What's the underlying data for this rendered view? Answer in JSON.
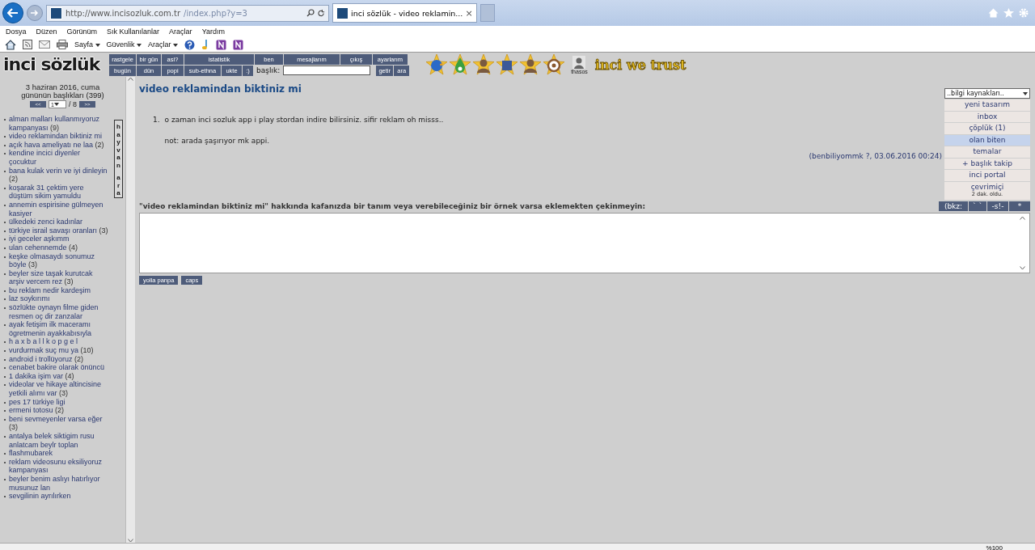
{
  "browser": {
    "address": {
      "host": "http://www.incisozluk.com.tr",
      "path": "/index.php?y=3"
    },
    "tabs": [
      {
        "title": "inci sözlük - video reklamin...",
        "close": "×",
        "selected": true
      }
    ],
    "menu": [
      "Dosya",
      "Düzen",
      "Görünüm",
      "Sık Kullanılanlar",
      "Araçlar",
      "Yardım"
    ],
    "commands": [
      {
        "kind": "home"
      },
      {
        "kind": "feed"
      },
      {
        "kind": "mail"
      },
      {
        "kind": "print"
      },
      {
        "kind": "menu",
        "label": "Sayfa"
      },
      {
        "kind": "menu",
        "label": "Güvenlik"
      },
      {
        "kind": "menu",
        "label": "Araçlar"
      },
      {
        "kind": "help"
      },
      {
        "kind": "note"
      },
      {
        "kind": "onenote"
      },
      {
        "kind": "onenote"
      }
    ]
  },
  "site": {
    "logo": "inci sözlük",
    "slogan": "inci we trust",
    "nav_row_1": [
      "rastgele",
      "bir gün",
      "asl?",
      "istatistik",
      "ben",
      "mesajlarım",
      "çıkış",
      "ayarlarım"
    ],
    "nav_row_2": [
      "bugün",
      "dün",
      "popi",
      "sub-ethna",
      "ukte",
      ":)"
    ],
    "search": {
      "label": "başlık:",
      "buttons": [
        "getir",
        "ara"
      ]
    },
    "badges": [
      {
        "kind": "bird"
      },
      {
        "kind": "drop"
      },
      {
        "kind": "person"
      },
      {
        "kind": "square"
      },
      {
        "kind": "person"
      },
      {
        "kind": "ring"
      }
    ],
    "user": {
      "name": "thasos"
    }
  },
  "sidebar": {
    "date": "3 haziran 2016, cuma",
    "heading": "gününün başlıkları (399)",
    "pager": {
      "prev": "<<",
      "page": "1",
      "total": "/ 8",
      "next": ">>"
    },
    "vertical_button": "hayvan ara",
    "topics": [
      {
        "title": "alman malları kullanmıyoruz kampanyası",
        "count": "(9)"
      },
      {
        "title": "video reklamindan biktiniz mi"
      },
      {
        "title": "açık hava ameliyatı ne laa",
        "count": "(2)"
      },
      {
        "title": "kendine incici diyenler çocuktur"
      },
      {
        "title": "bana kulak verin ve iyi dinleyin",
        "count": "(2)"
      },
      {
        "title": "koşarak 31 çektim yere düştüm sikim yamuldu"
      },
      {
        "title": "annemin espirisine gülmeyen kasiyer"
      },
      {
        "title": "ülkedeki zenci kadınlar"
      },
      {
        "title": "türkiye israil savaşı oranları",
        "count": "(3)"
      },
      {
        "title": "iyi geceler aşkımm"
      },
      {
        "title": "ulan cehennemde",
        "count": "(4)"
      },
      {
        "title": "keşke olmasaydı sonumuz böyle",
        "count": "(3)"
      },
      {
        "title": "beyler size taşak kurutcak arşiv vercem rez",
        "count": "(3)"
      },
      {
        "title": "bu reklam nedir kardeşim"
      },
      {
        "title": "laz soykırımı"
      },
      {
        "title": "sözlükte oynayn filme giden resmen oç dir zanzalar"
      },
      {
        "title": "ayak fetişim ilk maceramı ögretmenin ayakkabısıyla"
      },
      {
        "title": "h a x b a l l k o p g e l"
      },
      {
        "title": "vurdurmak suç mu ya",
        "count": "(10)"
      },
      {
        "title": "android i trollüyoruz",
        "count": "(2)"
      },
      {
        "title": "cenabet bakire olarak önüncü"
      },
      {
        "title": "1 dakika işim var",
        "count": "(4)"
      },
      {
        "title": "videolar ve hikaye altincisine yetkili alımı var",
        "count": "(3)"
      },
      {
        "title": "pes 17 türkiye ligi"
      },
      {
        "title": "ermeni totosu",
        "count": "(2)"
      },
      {
        "title": "beni sevmeyenler varsa eğer",
        "count": "(3)"
      },
      {
        "title": "antalya belek siktigim rusu anlatcam beylr toplan"
      },
      {
        "title": "flashmubarek"
      },
      {
        "title": "reklam videosunu eksiliyoruz kampanyası"
      },
      {
        "title": "beyler benim aslıyı hatırlıyor musunuz lan"
      },
      {
        "title": "sevgilinin ayrılırken"
      }
    ]
  },
  "topic": {
    "title": "video reklamindan biktiniz mi",
    "entries": [
      {
        "number": "1.",
        "paragraphs": [
          "o zaman inci sozluk app i play stordan indire bilirsiniz. sifir reklam oh misss..",
          "not: arada şaşırıyor mk appi."
        ],
        "author": "(benbiliyommk ?, 03.06.2016 00:24)"
      }
    ],
    "prompt": "\"video reklamindan biktiniz mi\" hakkında kafanızda bir tanım veya verebileceğiniz bir örnek varsa eklemekten çekinmeyin:",
    "format_buttons": [
      "(bkz:",
      "` `",
      "-s!-",
      "*"
    ],
    "submit_buttons": [
      "yolla panpa",
      "caps"
    ]
  },
  "right_menu": {
    "select": "..bilgi kaynakları..",
    "items": [
      {
        "label": "yeni tasarım",
        "selected": false
      },
      {
        "label": "inbox",
        "selected": false
      },
      {
        "label": "çöplük (1)",
        "selected": false
      },
      {
        "label": "olan biten",
        "selected": true
      },
      {
        "label": "temalar",
        "selected": false
      },
      {
        "label": "+ başlık takip",
        "selected": false
      },
      {
        "label": "inci portal",
        "selected": false
      },
      {
        "label": "çevrimiçi",
        "note": "2 dak. oldu.",
        "selected": false
      }
    ]
  },
  "status_bar": {
    "zoom": "%100"
  }
}
